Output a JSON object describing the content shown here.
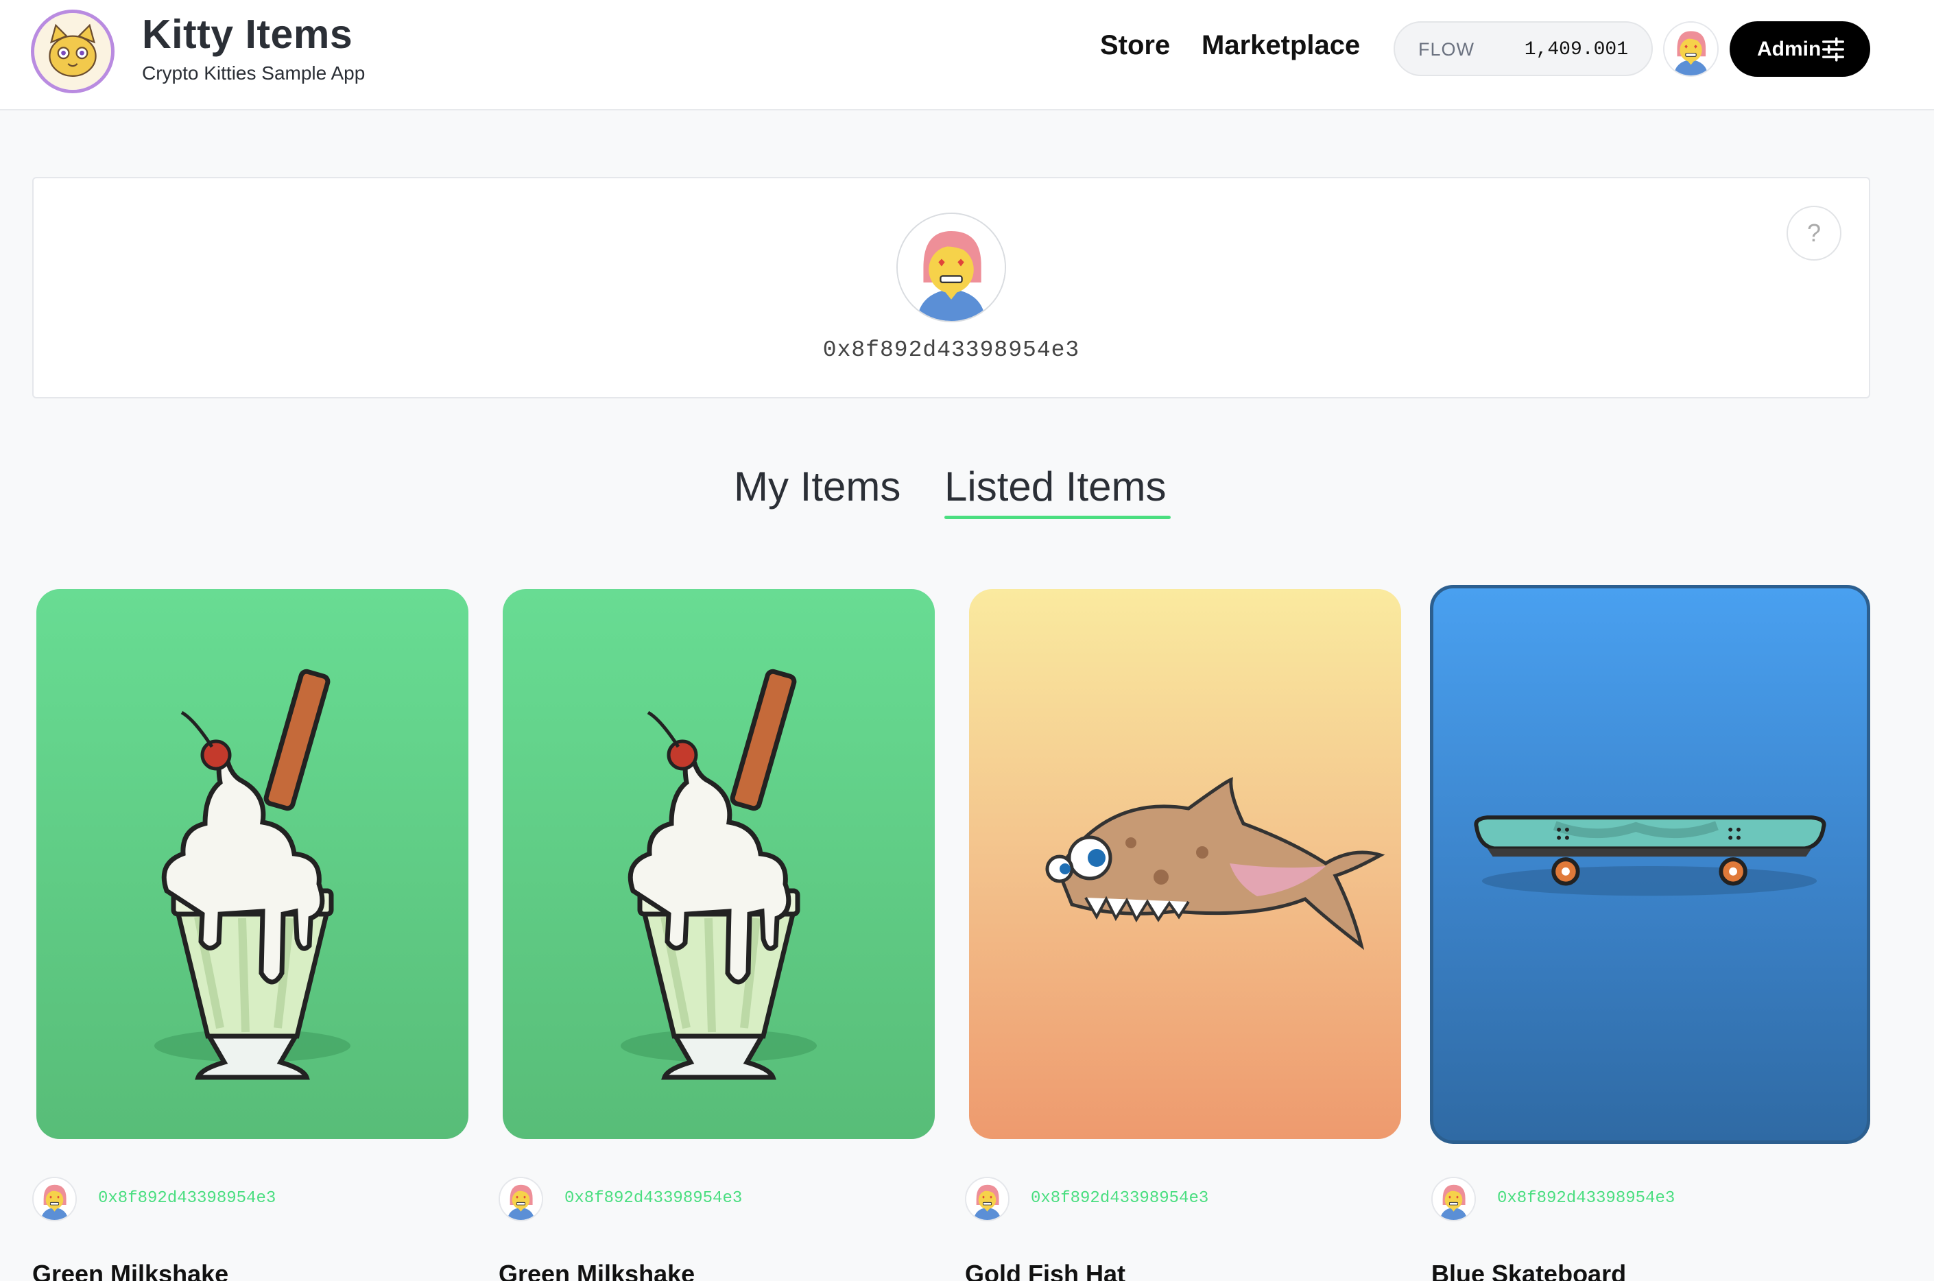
{
  "header": {
    "logo_icon": "kitty-logo-icon",
    "title": "Kitty Items",
    "subtitle": "Crypto Kitties Sample App",
    "nav": {
      "store": "Store",
      "marketplace": "Marketplace"
    },
    "balance": {
      "currency": "FLOW",
      "amount": "1,409.001"
    },
    "admin_label": "Admin",
    "admin_icon": "sliders-icon"
  },
  "profile": {
    "address": "0x8f892d43398954e3",
    "help_label": "?"
  },
  "tabs": {
    "my_items": "My Items",
    "listed_items": "Listed Items",
    "active": "Listed Items"
  },
  "items": [
    {
      "name": "Green Milkshake",
      "owner": "0x8f892d43398954e3",
      "kind": "milkshake",
      "color": "green"
    },
    {
      "name": "Green Milkshake",
      "owner": "0x8f892d43398954e3",
      "kind": "milkshake",
      "color": "green"
    },
    {
      "name": "Gold Fish Hat",
      "owner": "0x8f892d43398954e3",
      "kind": "fish-hat",
      "color": "gold"
    },
    {
      "name": "Blue Skateboard",
      "owner": "0x8f892d43398954e3",
      "kind": "skateboard",
      "color": "blue"
    }
  ],
  "colors": {
    "accent": "#4ade80",
    "admin_bg": "#000000",
    "page_bg": "#f8f9fa"
  }
}
